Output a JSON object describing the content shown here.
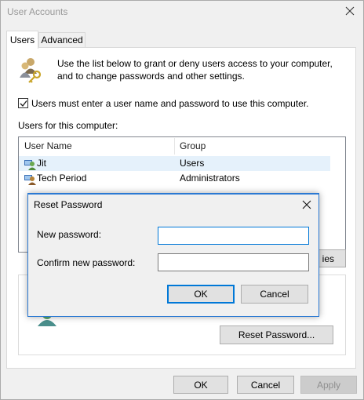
{
  "window": {
    "title": "User Accounts"
  },
  "tabs": [
    {
      "label": "Users",
      "active": true
    },
    {
      "label": "Advanced",
      "active": false
    }
  ],
  "intro_text_line1": "Use the list below to grant or deny users access to your computer,",
  "intro_text_line2": "and to change passwords and other settings.",
  "require_login": {
    "label": "Users must enter a user name and password to use this computer.",
    "checked": true
  },
  "users_label": "Users for this computer:",
  "users_table": {
    "columns": [
      "User Name",
      "Group"
    ],
    "rows": [
      {
        "name": "Jit",
        "group": "Users",
        "selected": true
      },
      {
        "name": "Tech Period",
        "group": "Administrators",
        "selected": false
      }
    ]
  },
  "properties_button_partial": "ies",
  "reset_password_button": "Reset Password...",
  "footer": {
    "ok": "OK",
    "cancel": "Cancel",
    "apply": "Apply"
  },
  "dialog": {
    "title": "Reset Password",
    "new_password_label": "New password:",
    "new_password_value": "",
    "confirm_label": "Confirm new password:",
    "confirm_value": "",
    "ok": "OK",
    "cancel": "Cancel"
  },
  "colors": {
    "accent": "#0078d7",
    "selection": "#e5f1fb",
    "dialog_border": "#2b79d3"
  }
}
